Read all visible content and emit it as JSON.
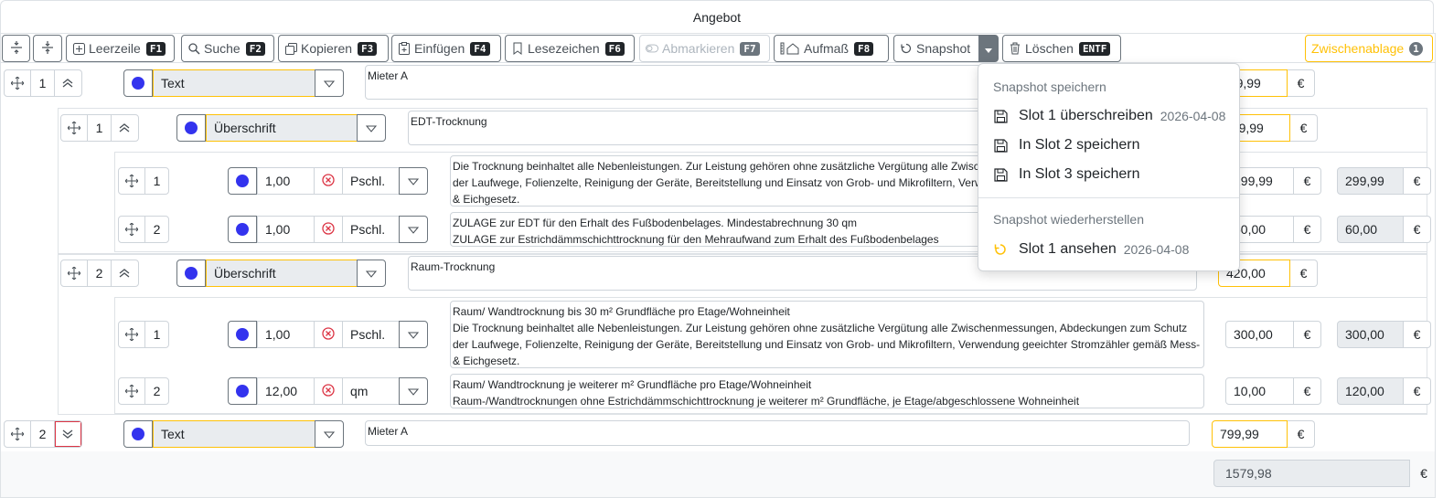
{
  "title": "Angebot",
  "toolbar": {
    "leerzeile": "Leerzeile",
    "leerzeile_key": "F1",
    "suche": "Suche",
    "suche_key": "F2",
    "kopieren": "Kopieren",
    "kopieren_key": "F3",
    "einfuegen": "Einfügen",
    "einfuegen_key": "F4",
    "lesezeichen": "Lesezeichen",
    "lesezeichen_key": "F6",
    "abmarkieren": "Abmarkieren",
    "abmarkieren_key": "F7",
    "aufmass": "Aufmaß",
    "aufmass_key": "F8",
    "snapshot": "Snapshot",
    "loeschen": "Löschen",
    "loeschen_key": "ENTF",
    "zwischenablage": "Zwischenablage",
    "zwischenablage_count": "1"
  },
  "rows": {
    "r1": {
      "pos": "1",
      "type": "Text",
      "text": "Mieter A",
      "price": "799,99",
      "cur": "€"
    },
    "r2": {
      "pos": "1",
      "type": "Überschrift",
      "text": "EDT-Trocknung",
      "price": "359,99",
      "cur": "€"
    },
    "r3": {
      "pos": "1",
      "qty": "1,00",
      "unit": "Pschl.",
      "text1": "Die Trocknung beinhaltet alle Nebenleistungen. Zur Leistung gehören ohne zusätzliche Vergütung alle Zwischenmessungen, Abdeckungen zum Schutz",
      "text2": "der Laufwege, Folienzelte, Reinigung der Geräte, Bereitstellung und Einsatz von Grob- und Mikrofiltern, Verwendung geeichter Stromzähler gemäß Mess-",
      "text3": "& Eichgesetz.",
      "price": "299,99",
      "total": "299,99",
      "cur": "€"
    },
    "r4": {
      "pos": "2",
      "qty": "1,00",
      "unit": "Pschl.",
      "text1": "ZULAGE zur EDT für den Erhalt des Fußbodenbelages. Mindestabrechnung 30 qm",
      "text2": "ZULAGE zur Estrichdämmschichttrocknung für den Mehraufwand zum Erhalt des Fußbodenbelages",
      "price": "60,00",
      "total": "60,00",
      "cur": "€"
    },
    "r5": {
      "pos": "2",
      "type": "Überschrift",
      "text": "Raum-Trocknung",
      "price": "420,00",
      "cur": "€"
    },
    "r6": {
      "pos": "1",
      "qty": "1,00",
      "unit": "Pschl.",
      "text1": "Raum/ Wandtrocknung bis 30 m² Grundfläche pro Etage/Wohneinheit",
      "text2": "Die Trocknung beinhaltet alle Nebenleistungen. Zur Leistung gehören ohne zusätzliche Vergütung alle Zwischenmessungen, Abdeckungen zum Schutz",
      "text3": "der Laufwege, Folienzelte, Reinigung der Geräte, Bereitstellung und Einsatz von Grob- und Mikrofiltern, Verwendung geeichter Stromzähler gemäß Mess-",
      "text4": "& Eichgesetz.",
      "price": "300,00",
      "total": "300,00",
      "cur": "€"
    },
    "r7": {
      "pos": "2",
      "qty": "12,00",
      "unit": "qm",
      "text1": "Raum/ Wandtrocknung je weiterer m² Grundfläche pro Etage/Wohneinheit",
      "text2": "Raum-/Wandtrocknungen ohne Estrichdämmschichttrocknung je weiterer m² Grundfläche, je Etage/abgeschlossene Wohneinheit",
      "price": "10,00",
      "total": "120,00",
      "cur": "€"
    },
    "r8": {
      "pos": "2",
      "type": "Text",
      "text": "Mieter A",
      "price": "799,99",
      "cur": "€"
    }
  },
  "total": {
    "value": "1579,98",
    "cur": "€"
  },
  "menu": {
    "save_header": "Snapshot speichern",
    "slot1_overwrite": "Slot 1 überschreiben",
    "slot1_date": "2026-04-08",
    "slot2_save": "In Slot 2 speichern",
    "slot3_save": "In Slot 3 speichern",
    "restore_header": "Snapshot wiederherstellen",
    "slot1_view": "Slot 1 ansehen",
    "slot1_view_date": "2026-04-08"
  }
}
